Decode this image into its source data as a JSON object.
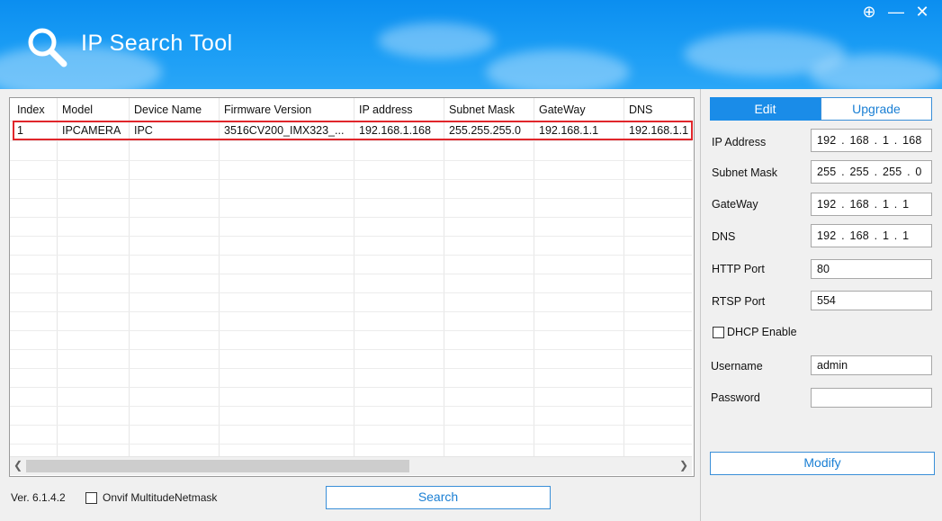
{
  "window": {
    "title": "IP Search Tool",
    "controls": [
      "⊕",
      "—",
      "✕"
    ]
  },
  "table": {
    "columns": [
      "Index",
      "Model",
      "Device Name",
      "Firmware Version",
      "IP address",
      "Subnet Mask",
      "GateWay",
      "DNS"
    ],
    "rows": [
      [
        "1",
        "IPCAMERA",
        "IPC",
        "3516CV200_IMX323_...",
        "192.168.1.168",
        "255.255.255.0",
        "192.168.1.1",
        "192.168.1.1"
      ]
    ],
    "selected_row": 0
  },
  "footer": {
    "version": "Ver. 6.1.4.2",
    "onvif_label": "Onvif MultitudeNetmask",
    "search_label": "Search"
  },
  "edit": {
    "tabs": [
      "Edit",
      "Upgrade"
    ],
    "active_tab": "Edit",
    "ip_address_label": "IP Address",
    "ip_address": "192 . 168 .  1  . 168",
    "subnet_mask_label": "Subnet Mask",
    "subnet_mask": "255 . 255 . 255 .  0",
    "gateway_label": "GateWay",
    "gateway": "192 . 168 .  1  .  1",
    "dns_label": "DNS",
    "dns": "192 . 168 .  1  .  1",
    "http_port_label": "HTTP Port",
    "http_port": "80",
    "rtsp_port_label": "RTSP Port",
    "rtsp_port": "554",
    "dhcp_label": "DHCP Enable",
    "username_label": "Username",
    "username": "admin",
    "password_label": "Password",
    "password": "",
    "modify_label": "Modify"
  },
  "colors": {
    "header_blue": "#1a9df5",
    "accent": "#1a7fd4",
    "selection_border": "#e0262b"
  }
}
